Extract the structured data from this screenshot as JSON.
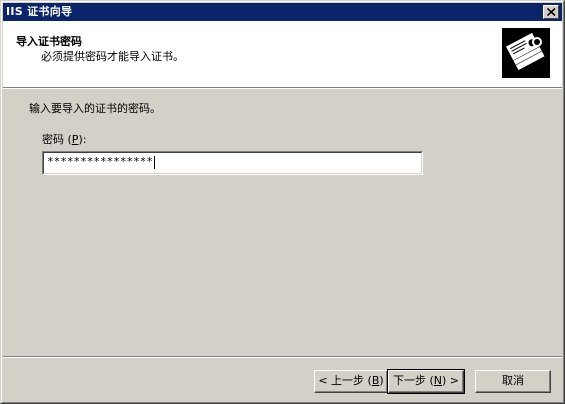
{
  "window": {
    "title": "IIS 证书向导"
  },
  "header": {
    "title": "导入证书密码",
    "subtitle": "必须提供密码才能导入证书。",
    "logo_icon": "certificate-icon"
  },
  "body": {
    "instruction": "输入要导入的证书的密码。",
    "password_label_prefix": "密码 (",
    "password_label_mnemonic": "P",
    "password_label_suffix": "):",
    "password_value": "****************"
  },
  "buttons": {
    "back_prefix": "< 上一步 (",
    "back_mnemonic": "B",
    "back_suffix": ")",
    "next_prefix": "下一步 (",
    "next_mnemonic": "N",
    "next_suffix": ") >",
    "cancel": "取消"
  },
  "colors": {
    "titlebar": "#0a246a",
    "dialog_bg": "#d4d0c8",
    "header_bg": "#ffffff"
  }
}
